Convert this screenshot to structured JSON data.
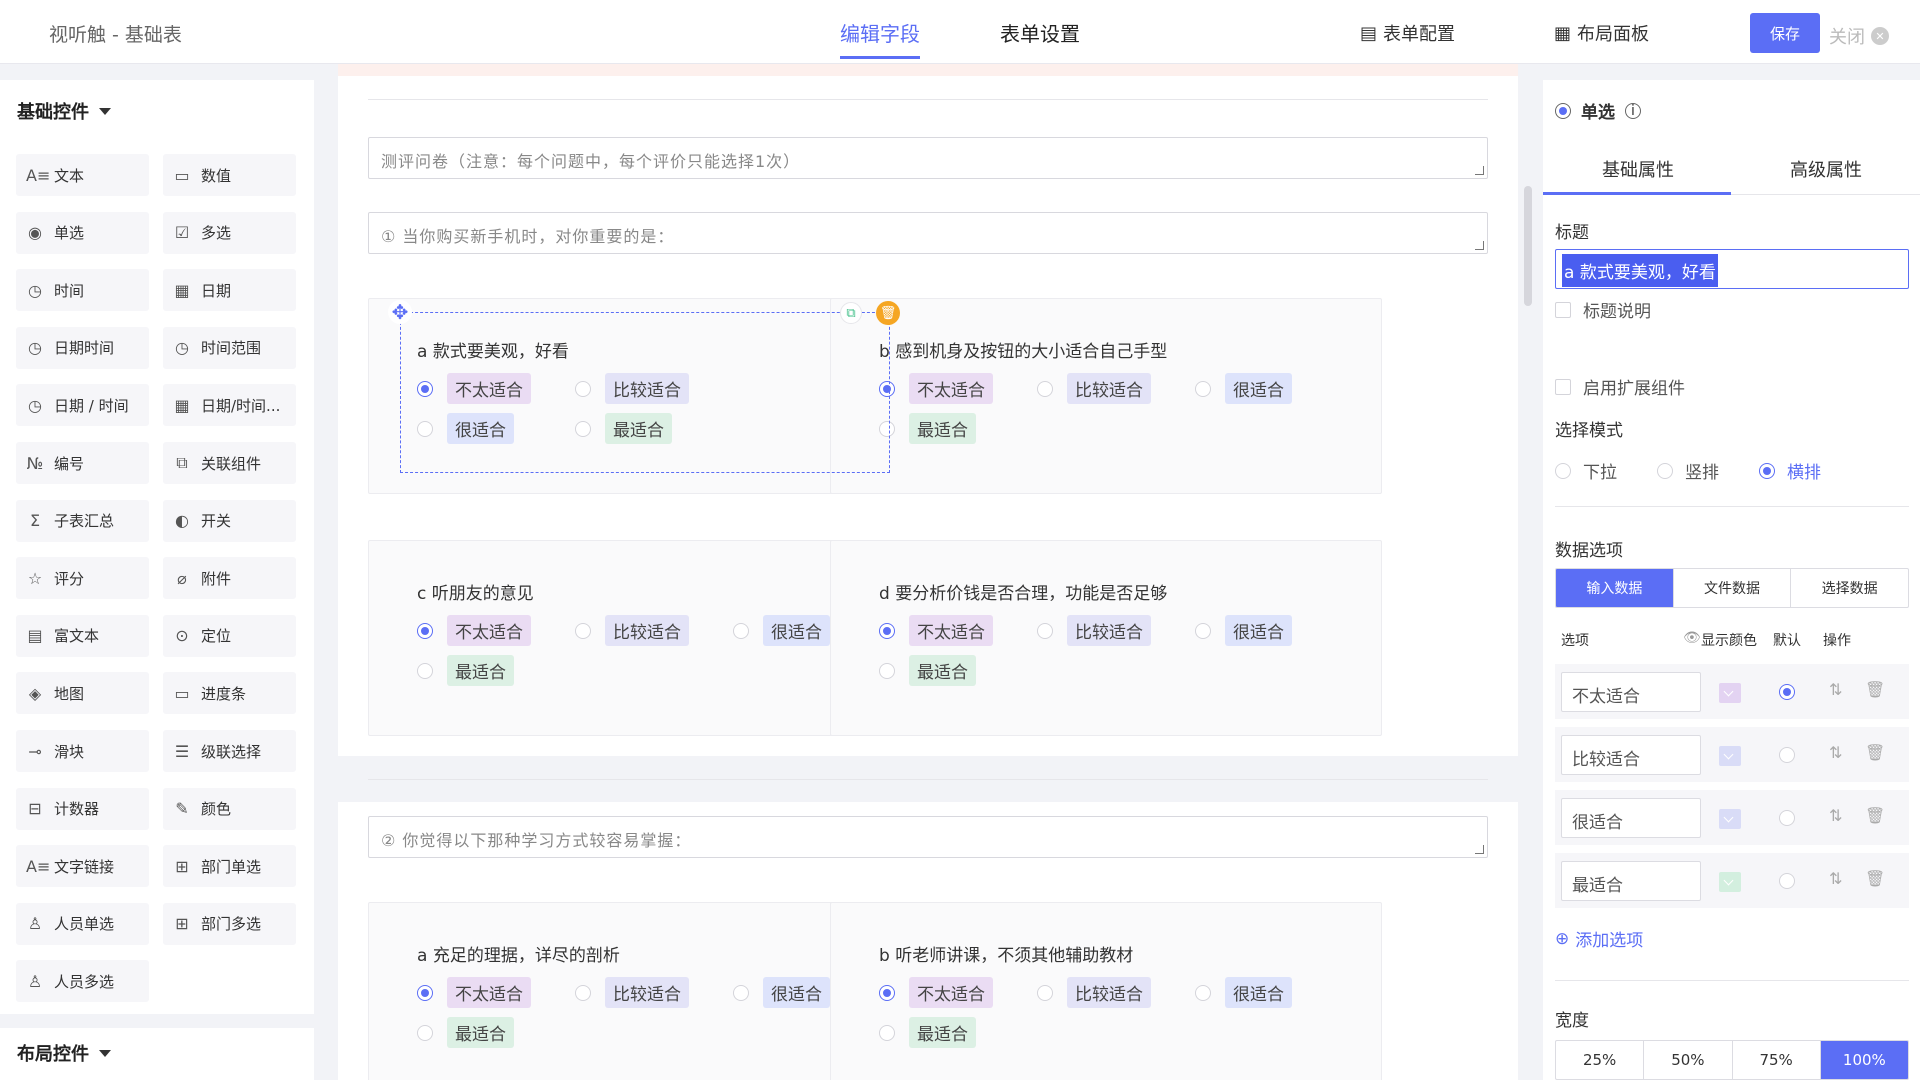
{
  "app_title": "视听触 - 基础表",
  "top_tabs": [
    "编辑字段",
    "表单设置"
  ],
  "top_actions": {
    "form_config": "表单配置",
    "layout_panel": "布局面板",
    "save": "保存",
    "close": "关闭"
  },
  "left": {
    "basic_heading": "基础控件",
    "layout_heading": "布局控件",
    "controls": [
      {
        "label": "文本",
        "icon": "text-icon",
        "glyph": "A≡"
      },
      {
        "label": "数值",
        "icon": "number-icon",
        "glyph": "▭"
      },
      {
        "label": "单选",
        "icon": "radio-icon",
        "glyph": "◉"
      },
      {
        "label": "多选",
        "icon": "checkbox-icon",
        "glyph": "☑"
      },
      {
        "label": "时间",
        "icon": "clock-icon",
        "glyph": "◷"
      },
      {
        "label": "日期",
        "icon": "calendar-icon",
        "glyph": "▦"
      },
      {
        "label": "日期时间",
        "icon": "clock-icon",
        "glyph": "◷"
      },
      {
        "label": "时间范围",
        "icon": "clock-icon",
        "glyph": "◷"
      },
      {
        "label": "日期 / 时间",
        "icon": "clock-icon",
        "glyph": "◷"
      },
      {
        "label": "日期/时间...",
        "icon": "calendar-icon",
        "glyph": "▦"
      },
      {
        "label": "编号",
        "icon": "serial-icon",
        "glyph": "№"
      },
      {
        "label": "关联组件",
        "icon": "link-component-icon",
        "glyph": "⧉"
      },
      {
        "label": "子表汇总",
        "icon": "sigma-icon",
        "glyph": "Σ"
      },
      {
        "label": "开关",
        "icon": "toggle-icon",
        "glyph": "◐"
      },
      {
        "label": "评分",
        "icon": "star-icon",
        "glyph": "☆"
      },
      {
        "label": "附件",
        "icon": "paperclip-icon",
        "glyph": "⌀"
      },
      {
        "label": "富文本",
        "icon": "richtext-icon",
        "glyph": "▤"
      },
      {
        "label": "定位",
        "icon": "location-icon",
        "glyph": "⊙"
      },
      {
        "label": "地图",
        "icon": "map-icon",
        "glyph": "◈"
      },
      {
        "label": "进度条",
        "icon": "progress-icon",
        "glyph": "▭"
      },
      {
        "label": "滑块",
        "icon": "slider-icon",
        "glyph": "⊸"
      },
      {
        "label": "级联选择",
        "icon": "cascade-icon",
        "glyph": "☰"
      },
      {
        "label": "计数器",
        "icon": "counter-icon",
        "glyph": "⊟"
      },
      {
        "label": "颜色",
        "icon": "color-picker-icon",
        "glyph": "✎"
      },
      {
        "label": "文字链接",
        "icon": "text-link-icon",
        "glyph": "A≡"
      },
      {
        "label": "部门单选",
        "icon": "department-icon",
        "glyph": "⊞"
      },
      {
        "label": "人员单选",
        "icon": "user-icon",
        "glyph": "♙"
      },
      {
        "label": "部门多选",
        "icon": "department-icon",
        "glyph": "⊞"
      },
      {
        "label": "人员多选",
        "icon": "users-icon",
        "glyph": "♙"
      }
    ]
  },
  "canvas": {
    "intro": "测评问卷（注意：每个问题中，每个评价只能选择1次）",
    "q1": "①   当你购买新手机时，对你重要的是：",
    "q2": "②   你觉得以下那种学习方式较容易掌握：",
    "cards": [
      {
        "q": "a 款式要美观，好看",
        "opts": [
          "不太适合",
          "比较适合",
          "很适合",
          "最适合"
        ]
      },
      {
        "q": "b 感到机身及按钮的大小适合自己手型",
        "opts": [
          "不太适合",
          "比较适合",
          "很适合",
          "最适合"
        ]
      },
      {
        "q": "c 听朋友的意见",
        "opts": [
          "不太适合",
          "比较适合",
          "很适合",
          "最适合"
        ]
      },
      {
        "q": "d 要分析价钱是否合理，功能是否足够",
        "opts": [
          "不太适合",
          "比较适合",
          "很适合",
          "最适合"
        ]
      },
      {
        "q": "a 充足的理据，详尽的剖析",
        "opts": [
          "不太适合",
          "比较适合",
          "很适合",
          "最适合"
        ]
      },
      {
        "q": "b 听老师讲课，不须其他辅助教材",
        "opts": [
          "不太适合",
          "比较适合",
          "很适合",
          "最适合"
        ]
      }
    ],
    "tag_colors": [
      "#eadcf3",
      "#e3e3f7",
      "#dde3fb",
      "#dcf0e4"
    ]
  },
  "right": {
    "panel_title": "单选",
    "tabs": [
      "基础属性",
      "高级属性"
    ],
    "title_label": "标题",
    "title_value": "a 款式要美观，好看",
    "title_desc": "标题说明",
    "enable_ext": "启用扩展组件",
    "mode_label": "选择模式",
    "modes": [
      "下拉",
      "竖排",
      "横排"
    ],
    "data_label": "数据选项",
    "data_tabs": [
      "输入数据",
      "文件数据",
      "选择数据"
    ],
    "table_headers": {
      "option": "选项",
      "color": "显示颜色",
      "default": "默认",
      "action": "操作"
    },
    "options": [
      "不太适合",
      "比较适合",
      "很适合",
      "最适合"
    ],
    "option_colors": [
      "#e3d3f2",
      "#d9dcf7",
      "#d9dcf7",
      "#d3efdf"
    ],
    "add_option": "添加选项",
    "width_label": "宽度",
    "widths": [
      "25%",
      "50%",
      "75%",
      "100%"
    ]
  }
}
